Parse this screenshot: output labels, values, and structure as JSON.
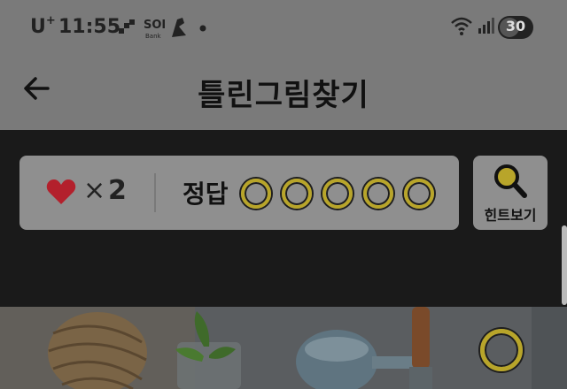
{
  "status_bar": {
    "carrier": "U",
    "carrier_sup": "+",
    "time": "11:55",
    "battery": "30"
  },
  "header": {
    "title": "틀린그림찾기",
    "back_icon": "arrow-left-icon"
  },
  "game": {
    "lives_icon": "heart-icon",
    "lives_times": "×",
    "lives": "2",
    "answer_label": "정답",
    "answers_total": 5,
    "answers_found": 0,
    "hint_label": "힌트보기",
    "hint_icon": "magnifier-icon"
  },
  "colors": {
    "heart": "#b3202c",
    "circle": "#b8a52a",
    "overlay_gray": "#7a7a7a"
  }
}
